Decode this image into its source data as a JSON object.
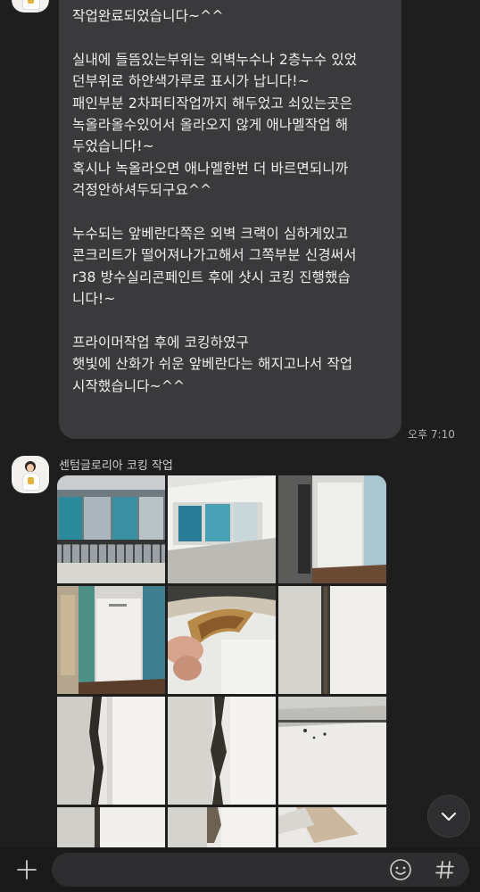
{
  "message": {
    "lines": [
      "작업완료되었습니다~^^",
      "",
      "실내에 들뜸있는부위는 외벽누수나 2층누수 있었",
      "던부위로 하얀색가루로 표시가 납니다!~",
      "패인부분 2차퍼티작업까지 해두었고 쇠있는곳은",
      "녹올라올수있어서 올라오지 않게 애나멜작업 해",
      "두었습니다!~",
      "혹시나 녹올라오면 애나멜한번 더 바르면되니까",
      "걱정안하셔두되구요^^",
      "",
      "누수되는 앞베란다쪽은 외벽 크랙이 심하게있고",
      "콘크리트가 떨어져나가고해서 그쪽부분 신경써서",
      "r38 방수실리콘페인트 후에 샷시 코킹 진행했습",
      "니다!~",
      "",
      "프라이머작업 후에 코킹하였구",
      "햇빛에 산화가 쉬운 앞베란다는 해지고나서 작업",
      "시작했습니다~^^"
    ],
    "time": "오후 7:10"
  },
  "photo_message": {
    "sender": "센텀글로리아 코킹 작업"
  },
  "input_bar": {
    "placeholder": ""
  },
  "colors": {
    "background": "#1e1e1e",
    "bubble": "#3a3a3c",
    "input": "#2e2e30"
  },
  "icons": [
    "plus-icon",
    "emoji-icon",
    "hash-icon",
    "chevron-down-icon"
  ]
}
